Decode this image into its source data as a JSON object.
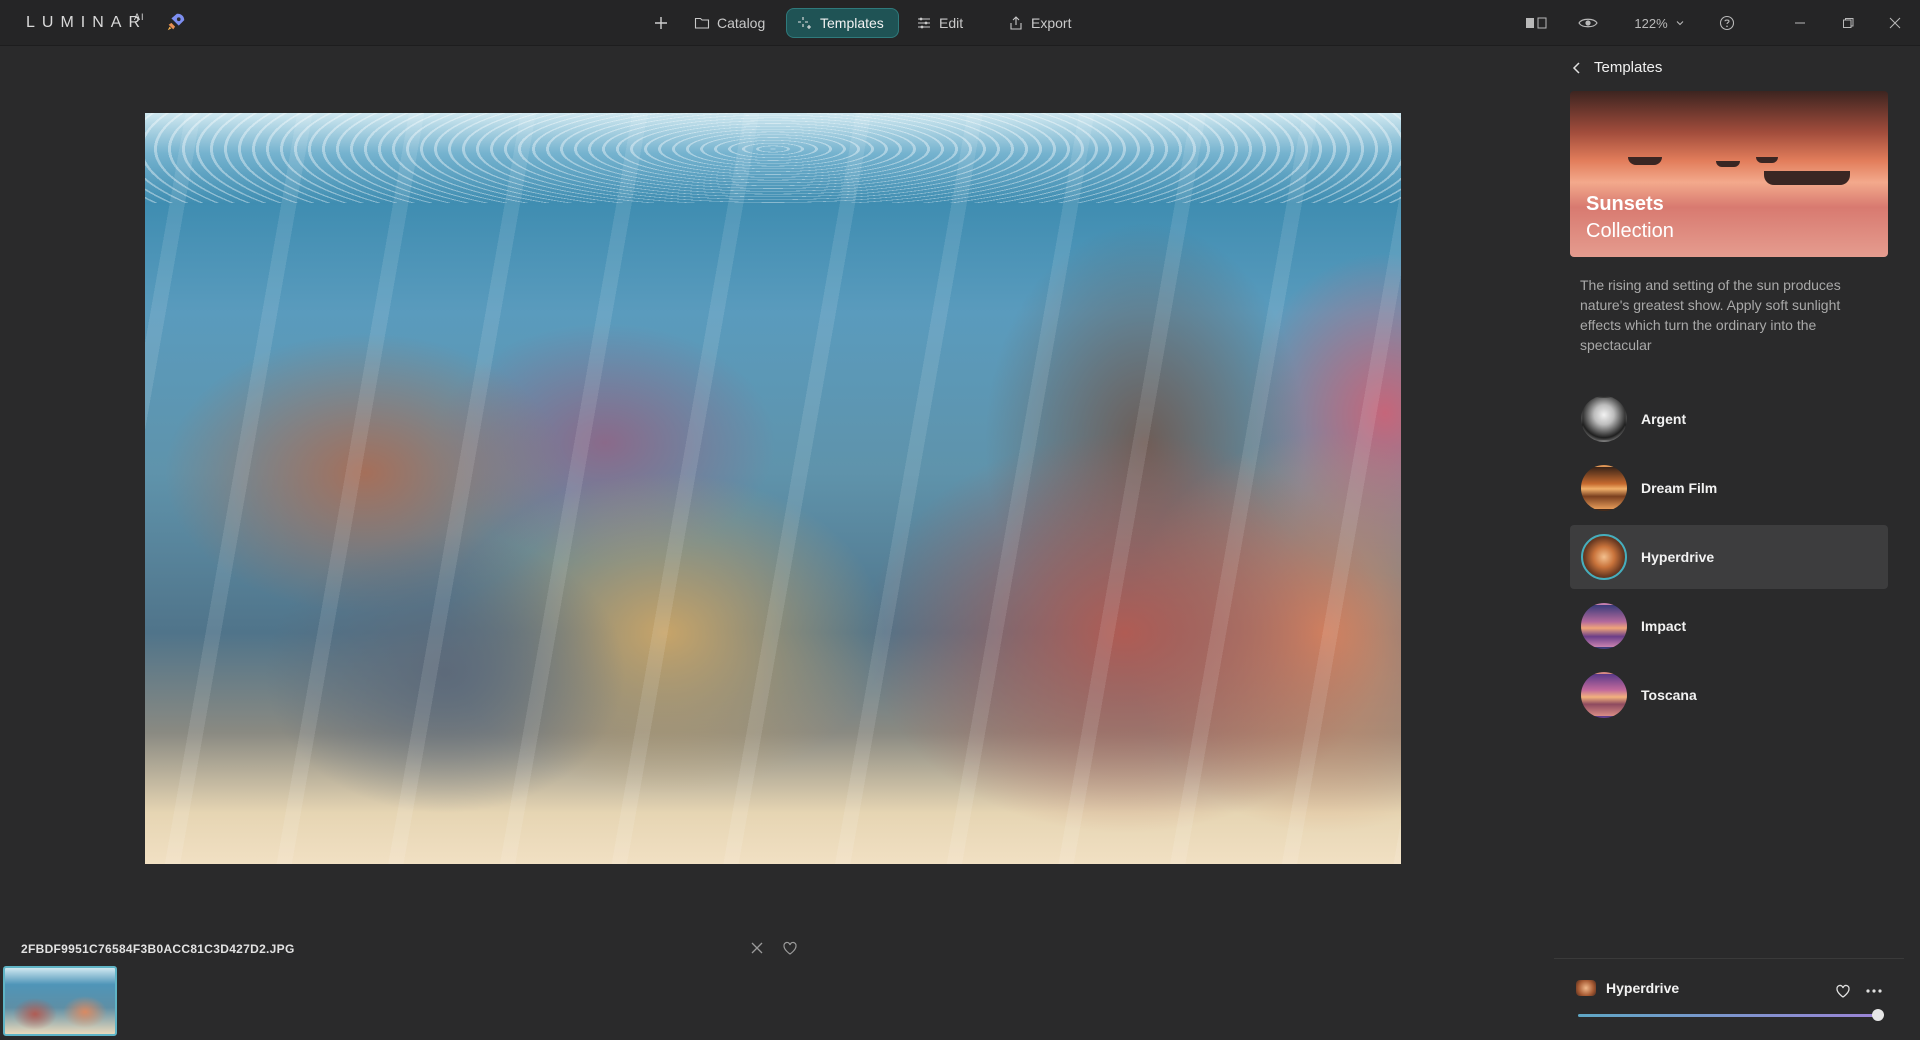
{
  "app": {
    "logo": "LUMINAR",
    "logo_sup": "AI"
  },
  "nav": {
    "catalog": "Catalog",
    "templates": "Templates",
    "edit": "Edit",
    "export": "Export",
    "zoom": "122%"
  },
  "canvas": {
    "image_icon": "photo-coral-reef"
  },
  "filmstrip": {
    "filename": "2FBDF9951C76584F3B0ACC81C3D427D2.JPG"
  },
  "panel": {
    "header": "Templates",
    "collection": {
      "line1": "Sunsets",
      "line2": "Collection"
    },
    "description": "The rising and setting of the sun produces nature's greatest show. Apply soft sunlight effects which turn the ordinary into the spectacular",
    "templates": [
      {
        "name": "Argent"
      },
      {
        "name": "Dream Film"
      },
      {
        "name": "Hyperdrive",
        "selected": true
      },
      {
        "name": "Impact"
      },
      {
        "name": "Toscana"
      }
    ]
  },
  "current": {
    "name": "Hyperdrive",
    "amount": 1.0
  },
  "colors": {
    "accent": "#2f7a7c",
    "selected_ring": "#46aebd",
    "panel": "#2a2a2b"
  }
}
